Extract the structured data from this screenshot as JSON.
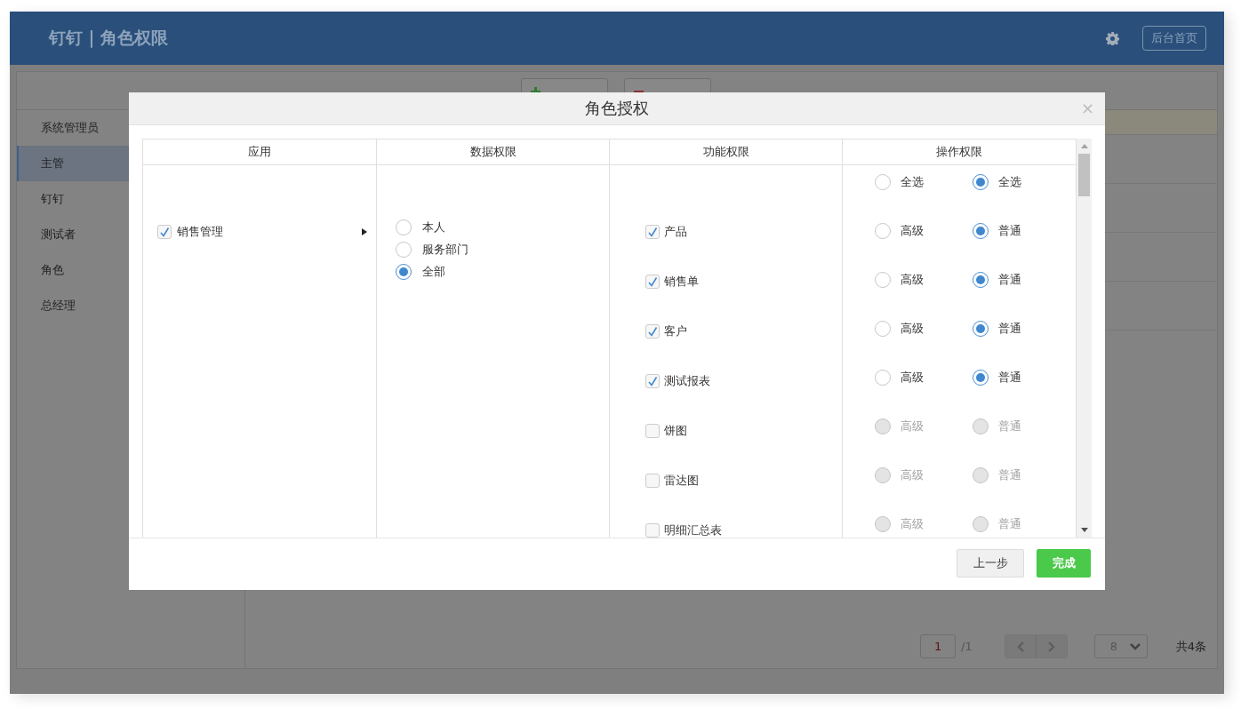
{
  "header": {
    "title": "钉钉 | 角色权限",
    "home_button": "后台首页"
  },
  "sidebar": {
    "items": [
      {
        "label": "系统管理员",
        "selected": false
      },
      {
        "label": "主管",
        "selected": true
      },
      {
        "label": "钉钉",
        "selected": false
      },
      {
        "label": "测试者",
        "selected": false
      },
      {
        "label": "角色",
        "selected": false
      },
      {
        "label": "总经理",
        "selected": false
      }
    ]
  },
  "pagination": {
    "page": "1",
    "total_pages": "/1",
    "page_size": "8",
    "total": "共4条"
  },
  "dialog": {
    "title": "角色授权",
    "close": "×",
    "columns": [
      "应用",
      "数据权限",
      "功能权限",
      "操作权限"
    ],
    "apps": [
      {
        "label": "销售管理",
        "checked": true
      }
    ],
    "data_scopes": [
      {
        "label": "本人",
        "selected": false
      },
      {
        "label": "服务部门",
        "selected": false
      },
      {
        "label": "全部",
        "selected": true
      }
    ],
    "select_all": [
      {
        "label": "全选",
        "selected": false
      },
      {
        "label": "全选",
        "selected": true
      }
    ],
    "functions": [
      {
        "label": "产品",
        "checked": true,
        "disabled": false,
        "options": [
          {
            "label": "高级",
            "selected": false
          },
          {
            "label": "普通",
            "selected": true
          }
        ]
      },
      {
        "label": "销售单",
        "checked": true,
        "disabled": false,
        "options": [
          {
            "label": "高级",
            "selected": false
          },
          {
            "label": "普通",
            "selected": true
          }
        ]
      },
      {
        "label": "客户",
        "checked": true,
        "disabled": false,
        "options": [
          {
            "label": "高级",
            "selected": false
          },
          {
            "label": "普通",
            "selected": true
          }
        ]
      },
      {
        "label": "测试报表",
        "checked": true,
        "disabled": false,
        "options": [
          {
            "label": "高级",
            "selected": false
          },
          {
            "label": "普通",
            "selected": true
          }
        ]
      },
      {
        "label": "饼图",
        "checked": false,
        "disabled": true,
        "options": [
          {
            "label": "高级",
            "selected": false
          },
          {
            "label": "普通",
            "selected": false
          }
        ]
      },
      {
        "label": "雷达图",
        "checked": false,
        "disabled": true,
        "options": [
          {
            "label": "高级",
            "selected": false
          },
          {
            "label": "普通",
            "selected": false
          }
        ]
      },
      {
        "label": "明细汇总表",
        "checked": false,
        "disabled": true,
        "options": [
          {
            "label": "高级",
            "selected": false
          },
          {
            "label": "普通",
            "selected": false
          }
        ]
      }
    ],
    "buttons": {
      "back": "上一步",
      "finish": "完成"
    }
  }
}
